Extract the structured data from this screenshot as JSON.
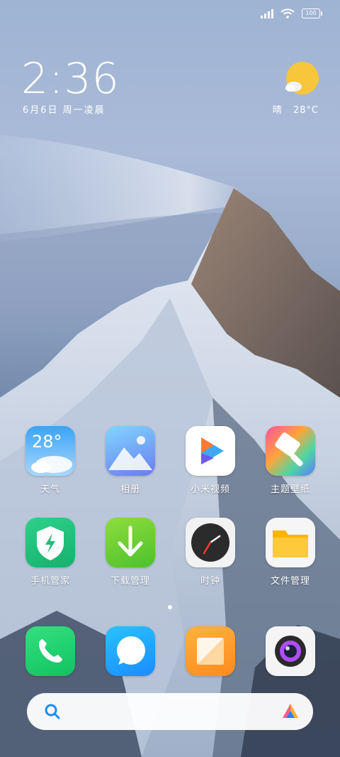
{
  "status": {
    "battery": "100"
  },
  "clock": {
    "time": "2:36",
    "date": "6月6日 周一凌晨"
  },
  "weather": {
    "condition": "晴",
    "temp": "28°C"
  },
  "apps": [
    {
      "label": "天气",
      "badge": "28°"
    },
    {
      "label": "相册"
    },
    {
      "label": "小米视频"
    },
    {
      "label": "主题壁纸"
    },
    {
      "label": "手机管家"
    },
    {
      "label": "下载管理"
    },
    {
      "label": "时钟"
    },
    {
      "label": "文件管理"
    }
  ],
  "dock": [
    {
      "name": "phone"
    },
    {
      "name": "messages"
    },
    {
      "name": "notes"
    },
    {
      "name": "camera"
    }
  ],
  "icons": {
    "weather": "sun-cloud-icon",
    "search": "search-icon",
    "assistant": "assistant-icon"
  }
}
